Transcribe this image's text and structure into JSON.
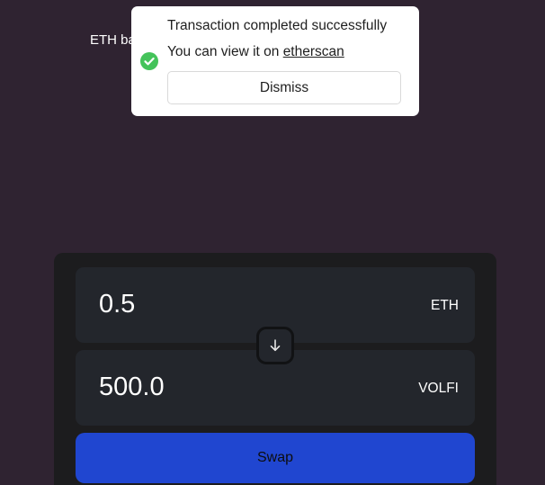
{
  "balance": {
    "label": "ETH balance: 0.12"
  },
  "toast": {
    "title": "Transaction completed successfully",
    "message_prefix": "You can view it on ",
    "link_text": "etherscan",
    "dismiss_label": "Dismiss",
    "status_icon": "check-circle-icon",
    "status_color": "#44c35a"
  },
  "swap": {
    "from": {
      "amount": "0.5",
      "token": "ETH"
    },
    "to": {
      "amount": "500.0",
      "token": "VOLFI"
    },
    "switch_icon": "arrow-down-icon",
    "button_label": "Swap",
    "button_color": "#2046d0"
  }
}
